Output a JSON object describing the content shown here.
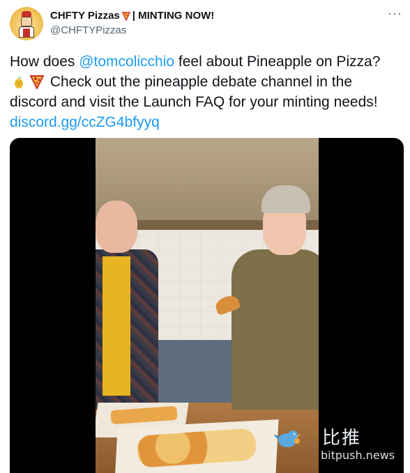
{
  "tweet": {
    "author": {
      "display_name": "CHFTY Pizzas",
      "name_suffix": " | MINTING NOW!",
      "handle": "@CHFTYPizzas",
      "avatar_icon": "chef-pizza-avatar-icon"
    },
    "more_icon": "more-dots-icon",
    "text": {
      "part1": "How does ",
      "mention": "@tomcolicchio",
      "part2": " feel about Pineapple on Pizza? ",
      "emoji_pineapple": "pineapple-emoji",
      "emoji_pizza": "pizza-emoji",
      "part3": " Check out the pineapple debate channel in the discord and visit the Launch FAQ for your minting needs! ",
      "link": "discord.gg/ccZG4bfyyq"
    },
    "media": {
      "type": "video"
    }
  },
  "watermark": {
    "zh": "比推",
    "en": "bitpush.news"
  },
  "colors": {
    "link": "#1d9bf0",
    "text": "#0f1419",
    "secondary": "#536471"
  }
}
